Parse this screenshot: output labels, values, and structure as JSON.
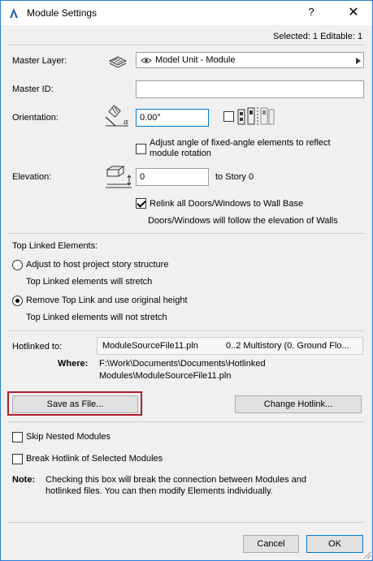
{
  "window": {
    "title": "Module Settings",
    "help": "?",
    "close": "✕"
  },
  "selection": {
    "text": "Selected: 1 Editable: 1"
  },
  "master_layer": {
    "label": "Master Layer:",
    "value": "Model Unit - Module"
  },
  "master_id": {
    "label": "Master ID:",
    "value": ""
  },
  "orientation": {
    "label": "Orientation:",
    "value": "0.00°",
    "adjust_checkbox_label": "Adjust angle of fixed-angle elements to reflect module rotation",
    "adjust_checked": false
  },
  "elevation": {
    "label": "Elevation:",
    "value": "0",
    "story_label": "to Story 0",
    "relink_label": "Relink all Doors/Windows to Wall Base",
    "relink_checked": true,
    "doors_note": "Doors/Windows will follow the elevation of Walls"
  },
  "top_linked": {
    "heading": "Top Linked Elements:",
    "option1": "Adjust to host project story structure",
    "option1_note": "Top Linked elements will stretch",
    "option2": "Remove Top Link and use original height",
    "option2_note": "Top Linked elements will not stretch",
    "selected": "option2"
  },
  "hotlink": {
    "label": "Hotlinked to:",
    "file": "ModuleSourceFile11.pln",
    "story": "0..2 Multistory (0. Ground Flo...",
    "where_label": "Where:",
    "where_line1": "F:\\Work\\Documents\\Documents\\Hotlinked",
    "where_line2": "Modules\\ModuleSourceFile11.pln"
  },
  "buttons": {
    "save_as_file": "Save as File...",
    "change_hotlink": "Change Hotlink...",
    "cancel": "Cancel",
    "ok": "OK"
  },
  "options": {
    "skip_nested": "Skip Nested Modules",
    "skip_nested_checked": false,
    "break_hotlink": "Break Hotlink of Selected Modules",
    "break_hotlink_checked": false
  },
  "note": {
    "label": "Note:",
    "line1": "Checking this box will break the connection between Modules and",
    "line2": "hotlinked files. You can then modify Elements individually."
  },
  "colors": {
    "accent": "#0078d7",
    "highlight": "#b01c2e",
    "titlebar_border": "#2b7bd6"
  }
}
